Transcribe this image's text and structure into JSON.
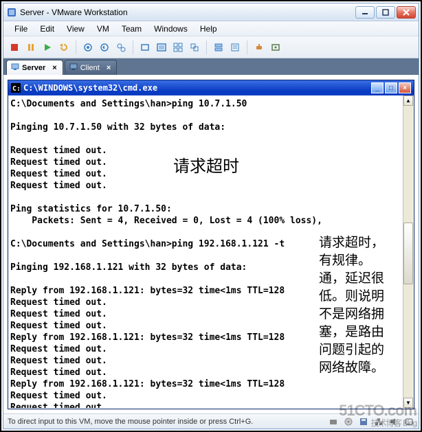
{
  "window": {
    "title": "Server - VMware Workstation"
  },
  "menu": {
    "items": [
      "File",
      "Edit",
      "View",
      "VM",
      "Team",
      "Windows",
      "Help"
    ]
  },
  "toolbar_icons": [
    "power-off-icon",
    "pause-icon",
    "play-icon",
    "reset-icon",
    "snapshot-take-icon",
    "snapshot-revert-icon",
    "snapshot-manage-icon",
    "show-console-icon",
    "fullscreen-icon",
    "quick-switch-icon",
    "unity-icon",
    "inventory-icon",
    "summary-icon",
    "connect-device-icon",
    "settings-icon"
  ],
  "tabs": [
    {
      "label": "Server",
      "active": true
    },
    {
      "label": "Client",
      "active": false
    }
  ],
  "cmd": {
    "title": "C:\\WINDOWS\\system32\\cmd.exe",
    "lines": [
      "C:\\Documents and Settings\\han>ping 10.7.1.50",
      "",
      "Pinging 10.7.1.50 with 32 bytes of data:",
      "",
      "Request timed out.",
      "Request timed out.",
      "Request timed out.",
      "Request timed out.",
      "",
      "Ping statistics for 10.7.1.50:",
      "    Packets: Sent = 4, Received = 0, Lost = 4 (100% loss),",
      "",
      "C:\\Documents and Settings\\han>ping 192.168.1.121 -t",
      "",
      "Pinging 192.168.1.121 with 32 bytes of data:",
      "",
      "Reply from 192.168.1.121: bytes=32 time<1ms TTL=128",
      "Request timed out.",
      "Request timed out.",
      "Request timed out.",
      "Reply from 192.168.1.121: bytes=32 time<1ms TTL=128",
      "Request timed out.",
      "Request timed out.",
      "Request timed out.",
      "Reply from 192.168.1.121: bytes=32 time<1ms TTL=128",
      "Request timed out.",
      "Request timed out."
    ]
  },
  "annotations": {
    "main": "请求超时",
    "side": "请求超时，有规律。\n通，延迟很低。则说明不是网络拥塞，是路由问题引起的网络故障。"
  },
  "status": {
    "text": "To direct input to this VM, move the mouse pointer inside or press Ctrl+G."
  },
  "watermark": {
    "main": "51CTO.com",
    "sub": "技术博客    Blog"
  }
}
